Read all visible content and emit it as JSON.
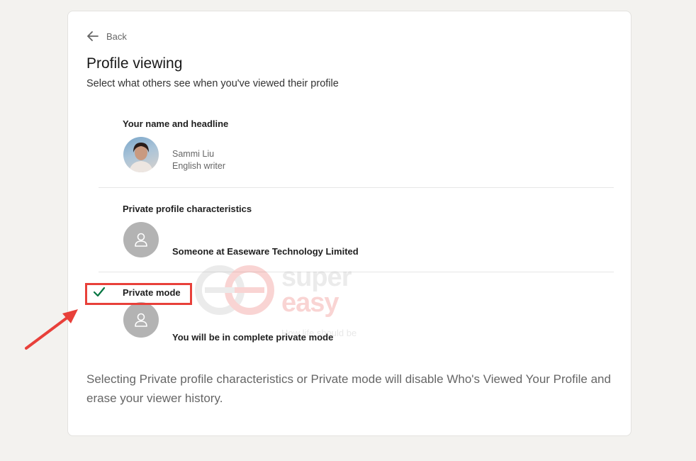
{
  "header": {
    "back_label": "Back",
    "title": "Profile viewing",
    "subtitle": "Select what others see when you've viewed their profile"
  },
  "options": [
    {
      "title": "Your name and headline",
      "name": "Sammi Liu",
      "headline": "English writer",
      "selected": false
    },
    {
      "title": "Private profile characteristics",
      "description": "Someone at Easeware Technology Limited",
      "selected": false
    },
    {
      "title": "Private mode",
      "description": "You will be in complete private mode",
      "selected": true
    }
  ],
  "footnote": "Selecting Private profile characteristics or Private mode will disable Who's Viewed Your Profile and erase your viewer history.",
  "watermark": {
    "word1": "super",
    "word2": "easy",
    "tagline": "How life should be"
  },
  "colors": {
    "check": "#057642",
    "annotation": "#e8403a",
    "page_background": "#f3f2ef"
  },
  "icons": {
    "back": "arrow-left-icon",
    "check": "checkmark-icon",
    "ghost_person": "person-silhouette-icon"
  }
}
